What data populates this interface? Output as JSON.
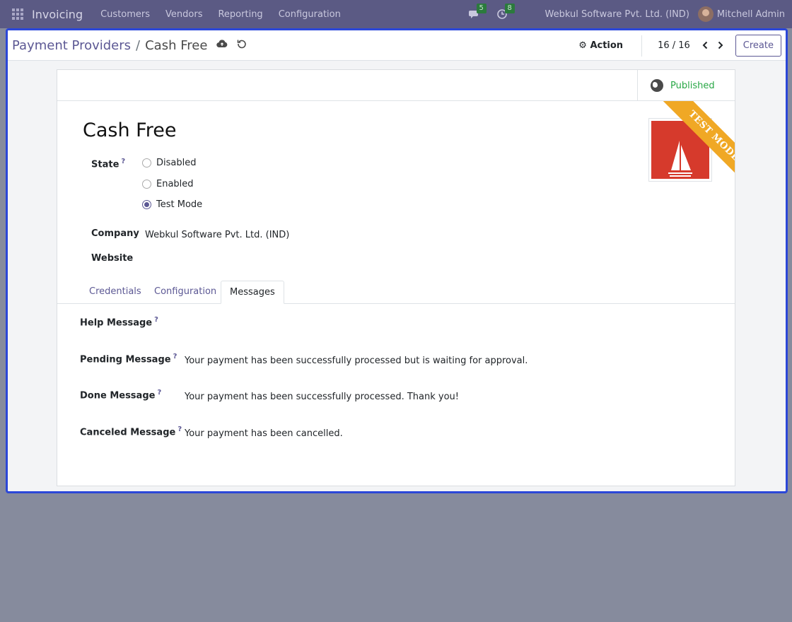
{
  "navbar": {
    "app_name": "Invoicing",
    "menu": [
      "Customers",
      "Vendors",
      "Reporting",
      "Configuration"
    ],
    "messages_count": "5",
    "activities_count": "8",
    "company": "Webkul Software Pvt. Ltd. (IND)",
    "user": "Mitchell Admin"
  },
  "control_panel": {
    "breadcrumb_parent": "Payment Providers",
    "breadcrumb_sep": "/",
    "breadcrumb_current": "Cash Free",
    "action_label": "Action",
    "pager": "16 / 16",
    "create_label": "Create"
  },
  "record": {
    "published_label": "Published",
    "name": "Cash Free",
    "ribbon": "TEST MODE",
    "state_label": "State",
    "state_options": [
      "Disabled",
      "Enabled",
      "Test Mode"
    ],
    "state_selected": "Test Mode",
    "company_label": "Company",
    "company_value": "Webkul Software Pvt. Ltd. (IND)",
    "website_label": "Website",
    "tabs": [
      "Credentials",
      "Configuration",
      "Messages"
    ],
    "active_tab": "Messages",
    "messages": [
      {
        "label": "Help Message",
        "value": ""
      },
      {
        "label": "Pending Message",
        "value": "Your payment has been successfully processed but is waiting for approval."
      },
      {
        "label": "Done Message",
        "value": "Your payment has been successfully processed. Thank you!"
      },
      {
        "label": "Canceled Message",
        "value": "Your payment has been cancelled."
      }
    ],
    "help_marker": "?"
  },
  "colors": {
    "navbar_bg": "#5b5a84",
    "brand": "#5c5894",
    "published": "#28a745",
    "ribbon": "#f0a825",
    "frame_border": "#2b47d8"
  }
}
